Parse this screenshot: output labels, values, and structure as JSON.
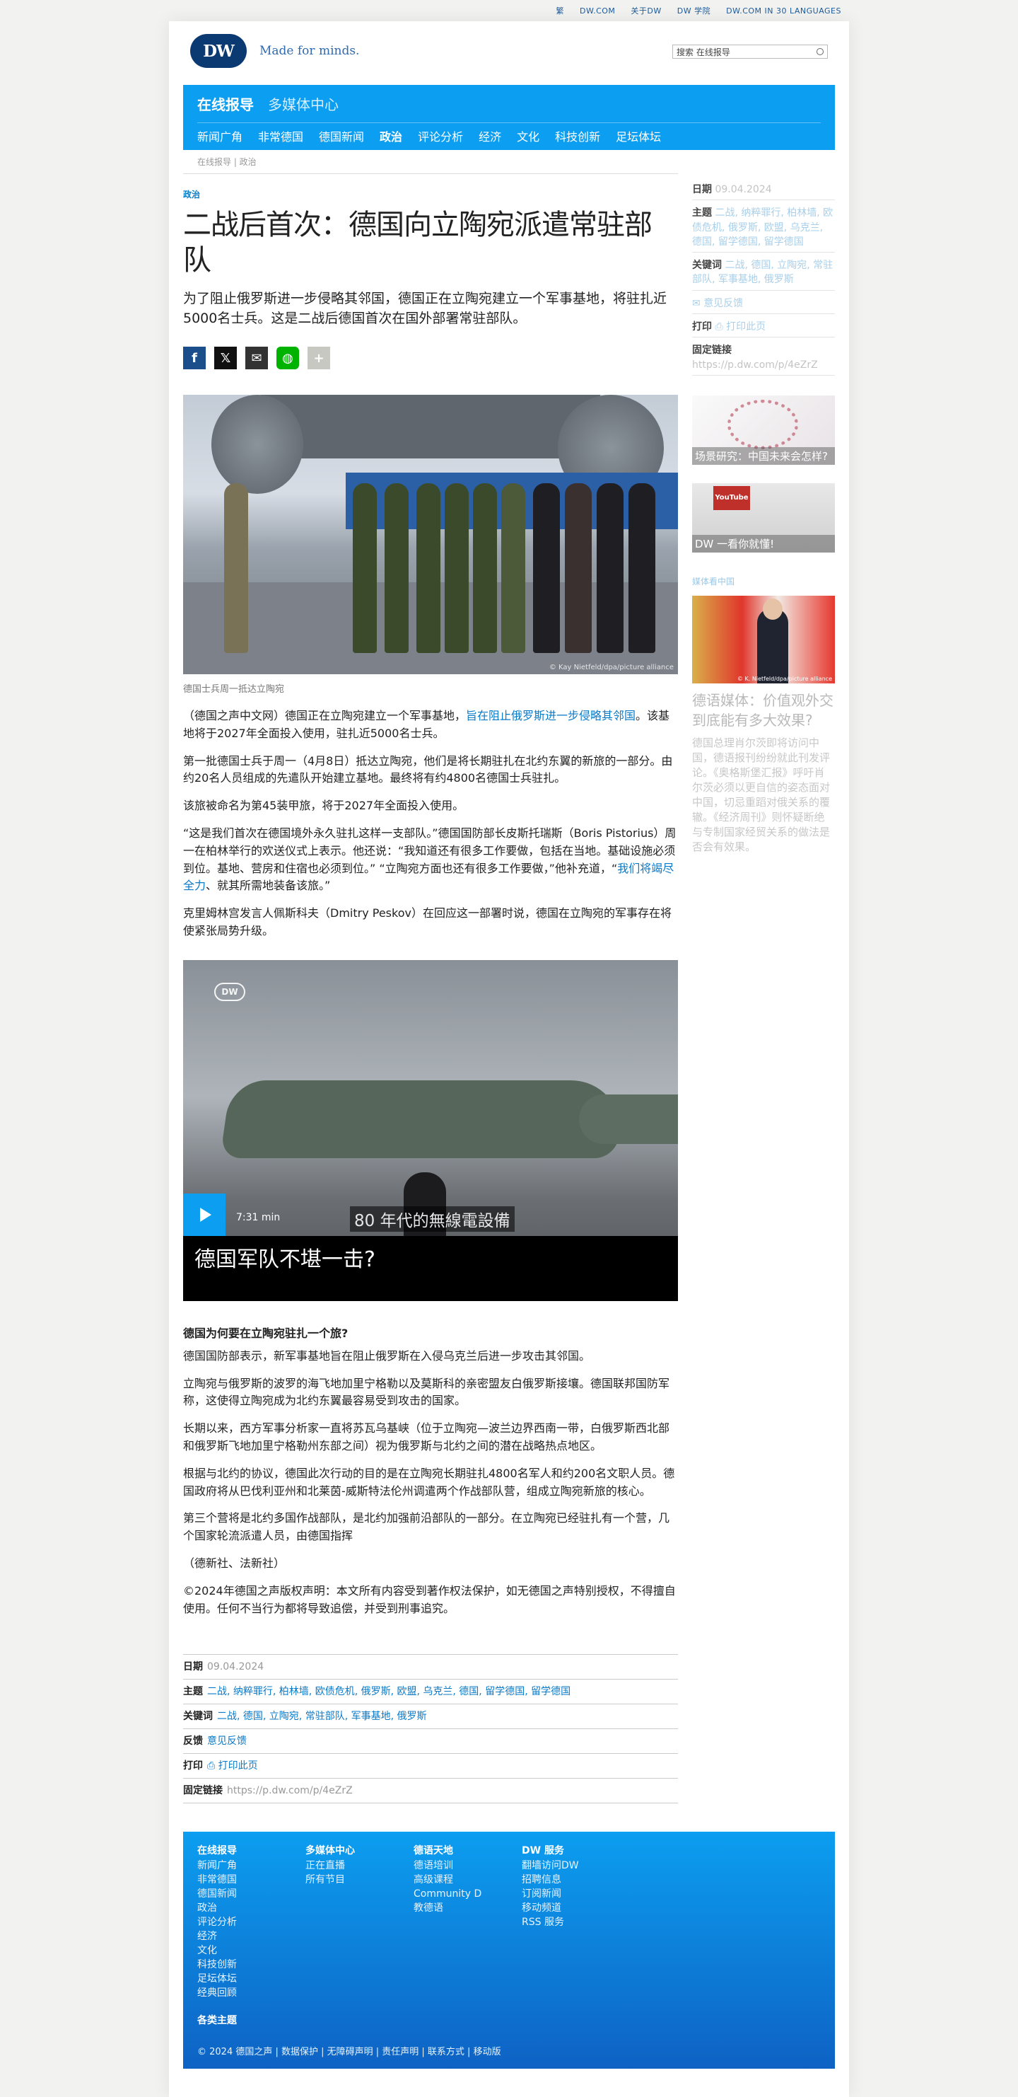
{
  "topbar": [
    "繁",
    "DW.COM",
    "关于DW",
    "DW 学院",
    "DW.COM IN 30 LANGUAGES"
  ],
  "header": {
    "logo_text": "DW",
    "slogan": "Made for minds.",
    "search_placeholder": "搜索 在线报导"
  },
  "nav": {
    "tabs": [
      "在线报导",
      "多媒体中心"
    ],
    "items": [
      "新闻广角",
      "非常德国",
      "德国新闻",
      "政治",
      "评论分析",
      "经济",
      "文化",
      "科技创新",
      "足坛体坛"
    ],
    "active": "政治"
  },
  "breadcrumb": "在线报导 | 政治",
  "article": {
    "kicker": "政治",
    "title": "二战后首次：德国向立陶宛派遣常驻部队",
    "lead": "为了阻止俄罗斯进一步侵略其邻国，德国正在立陶宛建立一个军事基地，将驻扎近5000名士兵。这是二战后德国首次在国外部署常驻部队。",
    "image_credit": "© Kay Nietfeld/dpa/picture alliance",
    "image_caption": "德国士兵周一抵达立陶宛",
    "p1_a": "（德国之声中文网）德国正在立陶宛建立一个军事基地，",
    "p1_link": "旨在阻止俄罗斯进一步侵略其邻国",
    "p1_b": "。该基地将于2027年全面投入使用，驻扎近5000名士兵。",
    "p2": "第一批德国士兵于周一（4月8日）抵达立陶宛，他们是将长期驻扎在北约东翼的新旅的一部分。由约20名人员组成的先遣队开始建立基地。最终将有约4800名德国士兵驻扎。",
    "p3": "该旅被命名为第45装甲旅，将于2027年全面投入使用。",
    "p4_a": "“这是我们首次在德国境外永久驻扎这样一支部队。”德国国防部长皮斯托瑞斯（Boris Pistorius）周一在柏林举行的欢送仪式上表示。他还说：“我知道还有很多工作要做，包括在当地。基础设施必须到位。基地、营房和住宿也必须到位。” “立陶宛方面也还有很多工作要做，”他补充道，“",
    "p4_link": "我们将竭尽全力",
    "p4_b": "、就其所需地装备该旅。”",
    "p5": "克里姆林宫发言人佩斯科夫（Dmitry Peskov）在回应这一部署时说，德国在立陶宛的军事存在将使紧张局势升级。",
    "video": {
      "badge": "DW",
      "subtitle": "80 年代的無線電設備",
      "duration": "7:31 min",
      "title": "德国军队不堪一击?"
    },
    "h2": "德国为何要在立陶宛驻扎一个旅?",
    "p6": "德国国防部表示，新军事基地旨在阻止俄罗斯在入侵乌克兰后进一步攻击其邻国。",
    "p7": "立陶宛与俄罗斯的波罗的海飞地加里宁格勒以及莫斯科的亲密盟友白俄罗斯接壤。德国联邦国防军称，这使得立陶宛成为北约东翼最容易受到攻击的国家。",
    "p8": "长期以来，西方军事分析家一直将苏瓦乌基峡（位于立陶宛—波兰边界西南一带，白俄罗斯西北部和俄罗斯飞地加里宁格勒州东部之间）视为俄罗斯与北约之间的潜在战略热点地区。",
    "p9": "根据与北约的协议，德国此次行动的目的是在立陶宛长期驻扎4800名军人和约200名文职人员。德国政府将从巴伐利亚州和北莱茵-威斯特法伦州调遣两个作战部队营，组成立陶宛新旅的核心。",
    "p10": "第三个营将是北约多国作战部队，是北约加强前沿部队的一部分。在立陶宛已经驻扎有一个营，几个国家轮流派遣人员，由德国指挥",
    "p11": "（德新社、法新社）",
    "p12": "©2024年德国之声版权声明：本文所有内容受到著作权法保护，如无德国之声特别授权，不得擅自使用。任何不当行为都将导致追偿，并受到刑事追究。"
  },
  "meta": {
    "date_label": "日期",
    "date": "09.04.2024",
    "topics_label": "主题",
    "topics": "二战, 纳粹罪行, 柏林墙, 欧债危机, 俄罗斯, 欧盟, 乌克兰, 德国, 留学德国, 留学德国",
    "keywords_label": "关键词",
    "keywords": "二战, 德国, 立陶宛, 常驻部队, 军事基地, 俄罗斯",
    "feedback_label": "反馈",
    "feedback": "意见反馈",
    "print_label": "打印",
    "print": "打印此页",
    "permalink_label": "固定链接",
    "permalink": "https://p.dw.com/p/4eZrZ"
  },
  "aside": {
    "date_label": "日期",
    "date": "09.04.2024",
    "topics_label": "主题",
    "topics": "二战, 纳粹罪行, 柏林墙, 欧债危机, 俄罗斯, 欧盟, 乌克兰, 德国, 留学德国, 留学德国",
    "keywords_label": "关键词",
    "keywords": "二战, 德国, 立陶宛, 常驻部队, 军事基地, 俄罗斯",
    "feedback": "意见反馈",
    "print_label": "打印",
    "print": "打印此页",
    "permalink_label": "固定链接",
    "permalink": "https://p.dw.com/p/4eZrZ",
    "teaser1": "场景研究：中国未来会怎样?",
    "teaser2": "DW 一看你就懂!",
    "teaser2_badge": "YouTube",
    "media_label": "媒体看中国",
    "teaser3_credit": "© K. Nietfeld/dpa/picture alliance",
    "story_title": "德语媒体：价值观外交到底能有多大效果?",
    "story_desc": "德国总理肖尔茨即将访问中国，德语报刊纷纷就此刊发评论。《奥格斯堡汇报》呼吁肖尔茨必须以更自信的姿态面对中国，切忌重蹈对俄关系的覆辙。《经济周刊》则怀疑断绝与专制国家经贸关系的做法是否会有效果。"
  },
  "footer": {
    "cols": [
      {
        "head": "在线报导",
        "items": [
          "新闻广角",
          "非常德国",
          "德国新闻",
          "政治",
          "评论分析",
          "经济",
          "文化",
          "科技创新",
          "足坛体坛",
          "经典回顾"
        ]
      },
      {
        "head": "多媒体中心",
        "items": [
          "正在直播",
          "所有节目"
        ]
      },
      {
        "head": "德语天地",
        "items": [
          "德语培训",
          "高级课程",
          "Community D",
          "教德语"
        ]
      },
      {
        "head": "DW 服务",
        "items": [
          "翻墙访问DW",
          "招聘信息",
          "订阅新闻",
          "移动频道",
          "RSS 服务"
        ]
      }
    ],
    "topics": "各类主题",
    "bottom": "© 2024 德国之声 | 数据保护 | 无障碍声明 | 责任声明 | 联系方式 | 移动版"
  }
}
